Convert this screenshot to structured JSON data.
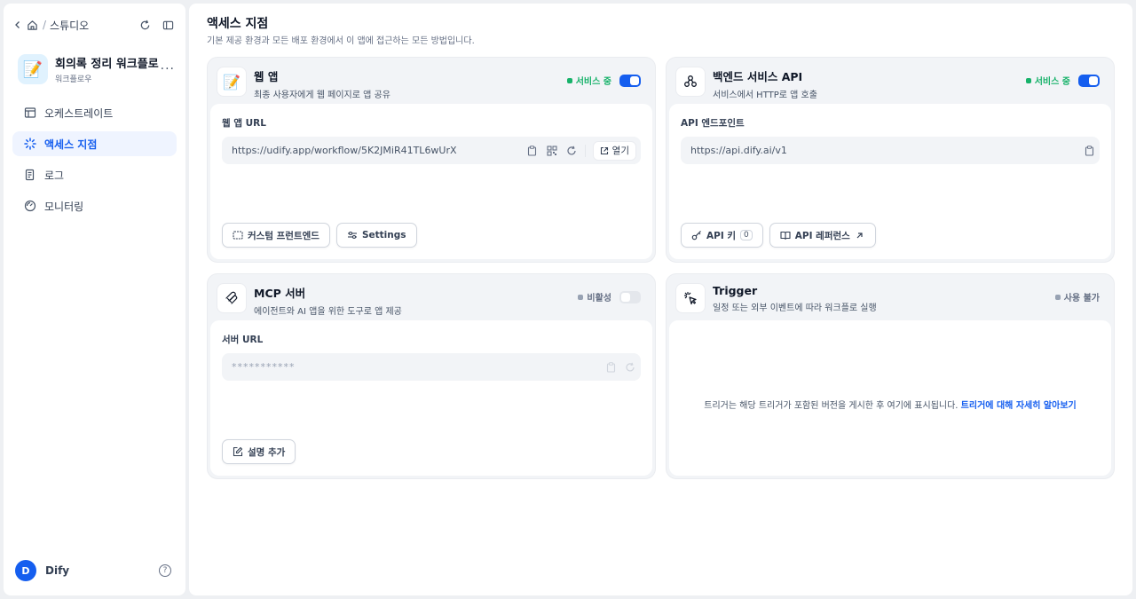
{
  "sidebar": {
    "breadcrumb": {
      "studio": "스튜디오"
    },
    "app": {
      "name": "회의록 정리 워크플로",
      "type": "워크플로우",
      "icon_emoji": "📝"
    },
    "nav": [
      {
        "label": "오케스트레이트",
        "icon": "layout-icon"
      },
      {
        "label": "액세스 지점",
        "icon": "access-icon",
        "active": true
      },
      {
        "label": "로그",
        "icon": "log-icon"
      },
      {
        "label": "모니터링",
        "icon": "monitor-icon"
      }
    ],
    "user": {
      "initial": "D",
      "name": "Dify"
    }
  },
  "page": {
    "title": "액세스 지점",
    "subtitle": "기본 제공 환경과 모든 배포 환경에서 이 앱에 접근하는 모든 방법입니다."
  },
  "webapp": {
    "title": "웹 앱",
    "desc": "최종 사용자에게 웹 페이지로 앱 공유",
    "status": "서비스 중",
    "url_label": "웹 앱 URL",
    "url": "https://udify.app/workflow/5K2JMiR41TL6wUrX",
    "open_label": "열기",
    "btn_custom": "커스텀 프런트엔드",
    "btn_settings": "Settings"
  },
  "api": {
    "title": "백엔드 서비스 API",
    "desc": "서비스에서 HTTP로 앱 호출",
    "status": "서비스 중",
    "endpoint_label": "API 엔드포인트",
    "endpoint": "https://api.dify.ai/v1",
    "btn_key": "API 키",
    "key_count": "0",
    "btn_reference": "API 레퍼런스"
  },
  "mcp": {
    "title": "MCP 서버",
    "desc": "에이전트와 AI 앱을 위한 도구로 앱 제공",
    "status": "비활성",
    "url_label": "서버 URL",
    "url_masked": "***********",
    "btn_desc": "설명 추가"
  },
  "trigger": {
    "title": "Trigger",
    "desc": "일정 또는 외부 이벤트에 따라 워크플로 실행",
    "status": "사용 불가",
    "message": "트리거는 해당 트리거가 포함된 버전을 게시한 후 여기에 표시됩니다. ",
    "link": "트리거에 대해 자세히 알아보기"
  },
  "colors": {
    "accent": "#155eef",
    "status_active": "#17b26a",
    "status_inactive": "#98a2b3"
  }
}
